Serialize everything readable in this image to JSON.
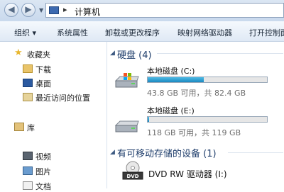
{
  "address": {
    "separator": "▸",
    "path": "计算机"
  },
  "toolbar": {
    "items": [
      "组织 ▾",
      "系统属性",
      "卸载或更改程序",
      "映射网络驱动器",
      "打开控制面"
    ]
  },
  "nav": {
    "favorites_label": "收藏夹",
    "favorites": [
      "下载",
      "桌面",
      "最近访问的位置"
    ],
    "libraries_label": "库",
    "libraries": [
      "视频",
      "图片",
      "文档"
    ]
  },
  "groups": {
    "hard_disks": "硬盘 (4)",
    "removable": "有可移动存储的设备 (1)"
  },
  "drives": [
    {
      "name": "本地磁盘 (C:)",
      "space": "43.8 GB 可用，共 82.4 GB",
      "used_fraction": 0.47,
      "bar_color": "#1a88c0"
    },
    {
      "name": "本地磁盘 (E:)",
      "space": "118 GB 可用，共 119 GB",
      "used_fraction": 0.01,
      "bar_color": "#1a88c0"
    }
  ],
  "removable_drive": {
    "name": "DVD RW 驱动器 (I:)",
    "icon_label": "DVD"
  }
}
